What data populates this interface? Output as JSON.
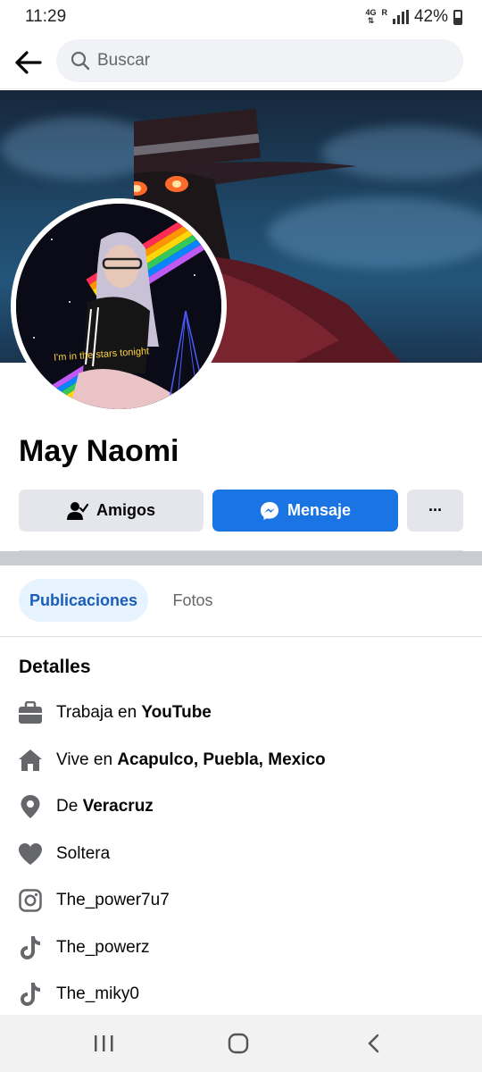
{
  "status_bar": {
    "time": "11:29",
    "network": "4G",
    "roaming": "R",
    "battery": "42%"
  },
  "search": {
    "placeholder": "Buscar"
  },
  "profile": {
    "name": "May Naomi",
    "avatar_caption": "I'm in the stars tonight",
    "buttons": {
      "friends": "Amigos",
      "message": "Mensaje",
      "more": "···"
    }
  },
  "tabs": [
    {
      "label": "Publicaciones",
      "active": true
    },
    {
      "label": "Fotos",
      "active": false
    }
  ],
  "details": {
    "title": "Detalles",
    "items": [
      {
        "icon": "briefcase-icon",
        "prefix": "Trabaja en ",
        "value": "YouTube"
      },
      {
        "icon": "home-icon",
        "prefix": "Vive en ",
        "value": "Acapulco, Puebla, Mexico"
      },
      {
        "icon": "location-pin-icon",
        "prefix": "De ",
        "value": "Veracruz"
      },
      {
        "icon": "heart-icon",
        "prefix": "Soltera",
        "value": ""
      },
      {
        "icon": "instagram-icon",
        "prefix": "The_power7u7",
        "value": ""
      },
      {
        "icon": "tiktok-icon",
        "prefix": "The_powerz",
        "value": ""
      },
      {
        "icon": "tiktok-icon",
        "prefix": "The_miky0",
        "value": ""
      }
    ]
  },
  "colors": {
    "accent": "#1b74e4",
    "active_tab_bg": "#e7f3ff",
    "button_gray": "#e4e6eb",
    "icon_gray": "#65676b"
  }
}
